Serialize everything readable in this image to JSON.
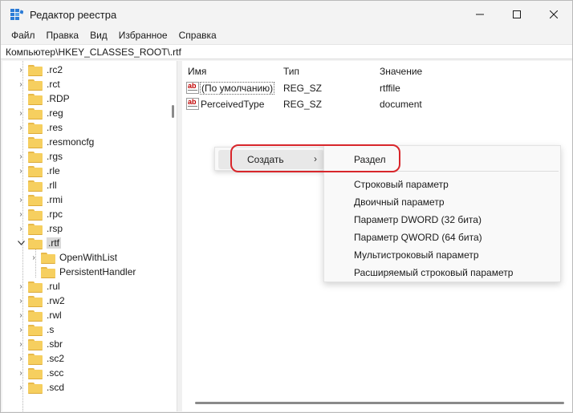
{
  "window": {
    "title": "Редактор реестра",
    "icon": "regedit-icon"
  },
  "menu": [
    "Файл",
    "Правка",
    "Вид",
    "Избранное",
    "Справка"
  ],
  "address": "Компьютер\\HKEY_CLASSES_ROOT\\.rtf",
  "tree": {
    "items": [
      {
        "label": ".rc2",
        "expandable": true
      },
      {
        "label": ".rct",
        "expandable": true
      },
      {
        "label": ".RDP",
        "expandable": false
      },
      {
        "label": ".reg",
        "expandable": true
      },
      {
        "label": ".res",
        "expandable": true
      },
      {
        "label": ".resmoncfg",
        "expandable": false
      },
      {
        "label": ".rgs",
        "expandable": true
      },
      {
        "label": ".rle",
        "expandable": true
      },
      {
        "label": ".rll",
        "expandable": false
      },
      {
        "label": ".rmi",
        "expandable": true
      },
      {
        "label": ".rpc",
        "expandable": true
      },
      {
        "label": ".rsp",
        "expandable": true
      },
      {
        "label": ".rtf",
        "expandable": true,
        "expanded": true,
        "selected": true
      },
      {
        "label": "OpenWithList",
        "expandable": true,
        "child": true
      },
      {
        "label": "PersistentHandler",
        "expandable": false,
        "child": true
      },
      {
        "label": ".rul",
        "expandable": true
      },
      {
        "label": ".rw2",
        "expandable": true
      },
      {
        "label": ".rwl",
        "expandable": true
      },
      {
        "label": ".s",
        "expandable": true
      },
      {
        "label": ".sbr",
        "expandable": true
      },
      {
        "label": ".sc2",
        "expandable": true
      },
      {
        "label": ".scc",
        "expandable": true
      },
      {
        "label": ".scd",
        "expandable": true
      }
    ]
  },
  "list": {
    "headers": {
      "name": "Имя",
      "type": "Тип",
      "value": "Значение"
    },
    "rows": [
      {
        "name": "(По умолчанию)",
        "type": "REG_SZ",
        "value": "rtffile"
      },
      {
        "name": "PerceivedType",
        "type": "REG_SZ",
        "value": "document"
      }
    ]
  },
  "context_menu": {
    "item": "Создать",
    "submenu": [
      "Раздел",
      "Строковый параметр",
      "Двоичный параметр",
      "Параметр DWORD (32 бита)",
      "Параметр QWORD (64 бита)",
      "Мультистроковый параметр",
      "Расширяемый строковый параметр"
    ]
  },
  "colors": {
    "folder": "#f6cf5f",
    "highlight_ring": "#d8262b",
    "window_bg": "#f3f3f3"
  }
}
